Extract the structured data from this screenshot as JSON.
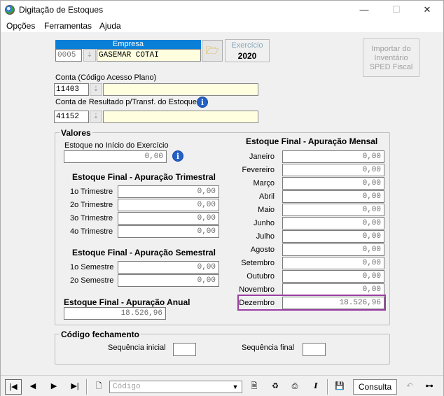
{
  "window": {
    "title": "Digitação de Estoques",
    "minimize": "—",
    "maximize": "☐",
    "close": "✕"
  },
  "menu": [
    "Opções",
    "Ferramentas",
    "Ajuda"
  ],
  "empresa": {
    "header": "Empresa",
    "code": "0005",
    "name": "GASEMAR COTAI"
  },
  "exercicio": {
    "label": "Exercício",
    "value": "2020"
  },
  "importar": {
    "label": "Importar do Inventário SPED Fiscal"
  },
  "conta": {
    "label": "Conta (Código Acesso Plano)",
    "code": "11403",
    "desc": ""
  },
  "conta_resultado": {
    "label": "Conta de Resultado p/Transf. do Estoque",
    "code": "41152",
    "desc": ""
  },
  "valores": {
    "title": "Valores",
    "inicio": {
      "label": "Estoque no Início do Exercício",
      "value": "0,00"
    },
    "trimestral": {
      "title": "Estoque Final - Apuração Trimestral",
      "rows": [
        {
          "label": "1o Trimestre",
          "value": "0,00"
        },
        {
          "label": "2o Trimestre",
          "value": "0,00"
        },
        {
          "label": "3o Trimestre",
          "value": "0,00"
        },
        {
          "label": "4o Trimestre",
          "value": "0,00"
        }
      ]
    },
    "semestral": {
      "title": "Estoque Final - Apuração Semestral",
      "rows": [
        {
          "label": "1o Semestre",
          "value": "0,00"
        },
        {
          "label": "2o Semestre",
          "value": "0,00"
        }
      ]
    },
    "anual": {
      "title": "Estoque Final - Apuração Anual",
      "value": "18.526,96"
    },
    "mensal": {
      "title": "Estoque Final - Apuração Mensal",
      "rows": [
        {
          "label": "Janeiro",
          "value": "0,00"
        },
        {
          "label": "Fevereiro",
          "value": "0,00"
        },
        {
          "label": "Março",
          "value": "0,00"
        },
        {
          "label": "Abril",
          "value": "0,00"
        },
        {
          "label": "Maio",
          "value": "0,00"
        },
        {
          "label": "Junho",
          "value": "0,00"
        },
        {
          "label": "Julho",
          "value": "0,00"
        },
        {
          "label": "Agosto",
          "value": "0,00"
        },
        {
          "label": "Setembro",
          "value": "0,00"
        },
        {
          "label": "Outubro",
          "value": "0,00"
        },
        {
          "label": "Novembro",
          "value": "0,00"
        },
        {
          "label": "Dezembro",
          "value": "18.526,96"
        }
      ]
    }
  },
  "fechamento": {
    "title": "Código fechamento",
    "seq_inicial_label": "Sequência inicial",
    "seq_inicial": "",
    "seq_final_label": "Sequência final",
    "seq_final": ""
  },
  "toolbar": {
    "codigo_placeholder": "Código",
    "consulta": "Consulta"
  },
  "colors": {
    "highlight": "#9b3fa3",
    "empresa_header": "#0a7fd8",
    "field_yellow": "#ffffe0"
  }
}
